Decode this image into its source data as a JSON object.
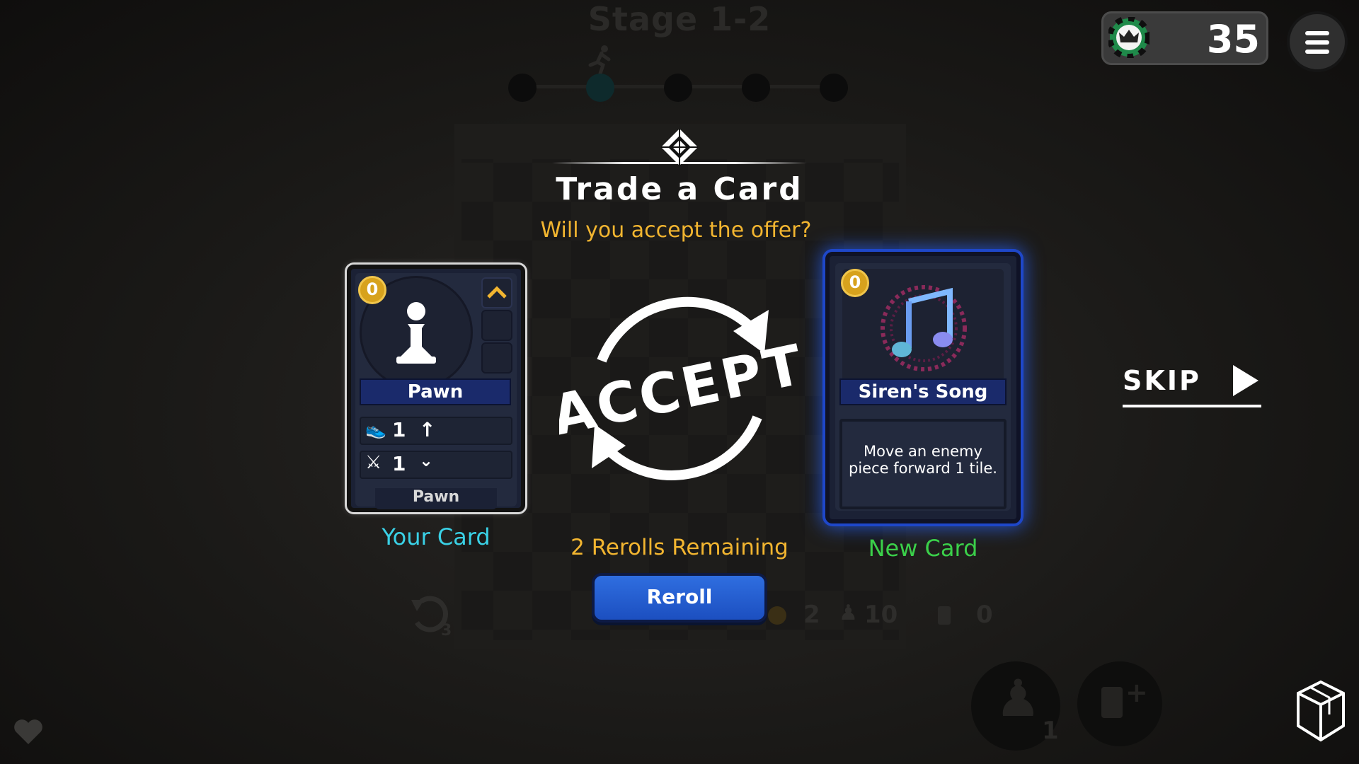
{
  "stage": {
    "title": "Stage 1-2"
  },
  "currency": {
    "value": "35",
    "icon": "crown-chip-icon"
  },
  "menu": {
    "icon": "hamburger-menu-icon"
  },
  "modal": {
    "title": "Trade a Card",
    "subtitle": "Will you accept the offer?",
    "accept_label": "ACCEPT",
    "rerolls_remaining": "2 Rerolls Remaining",
    "reroll_label": "Reroll",
    "skip_label": "SKIP"
  },
  "your_card": {
    "cost": "0",
    "name": "Pawn",
    "move_value": "1",
    "attack_value": "1",
    "type": "Pawn",
    "caption": "Your Card"
  },
  "new_card": {
    "cost": "0",
    "name": "Siren's Song",
    "description": "Move an enemy piece forward 1 tile.",
    "caption": "New Card"
  },
  "background": {
    "stat_a": "2",
    "stat_b": "10",
    "stat_c": "0",
    "undo_count": "3",
    "piece_count": "1"
  },
  "colors": {
    "accent_gold": "#f2b530",
    "your_card_caption": "#3ad1e6",
    "new_card_caption": "#3bd04a",
    "reroll_blue": "#2f6ee0",
    "new_card_glow": "#1e47c9"
  }
}
